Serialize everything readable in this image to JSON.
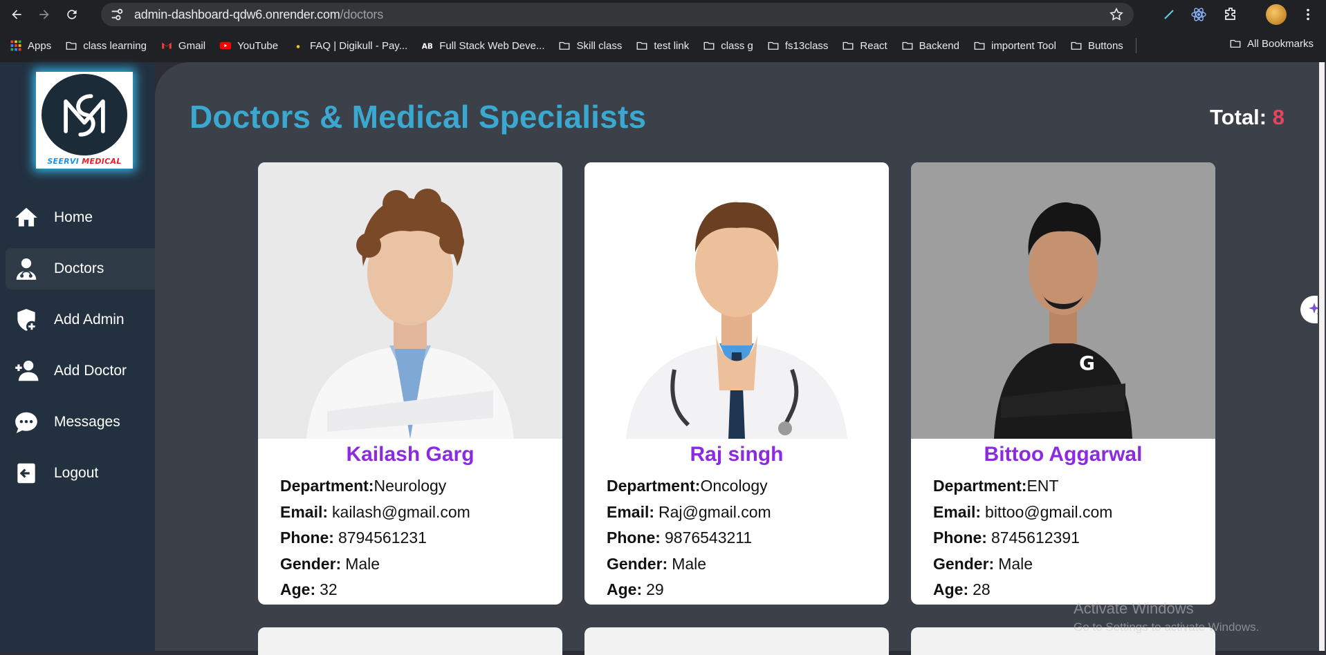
{
  "browser": {
    "url_host": "admin-dashboard-qdw6.onrender.com",
    "url_path": "/doctors",
    "bookmarks": [
      {
        "label": "Apps",
        "icon": "apps-grid-icon"
      },
      {
        "label": "class learning",
        "icon": "folder-icon"
      },
      {
        "label": "Gmail",
        "icon": "gmail-icon"
      },
      {
        "label": "YouTube",
        "icon": "youtube-icon"
      },
      {
        "label": "FAQ | Digikull - Pay...",
        "icon": "digikull-icon"
      },
      {
        "label": "Full Stack Web Deve...",
        "icon": "ab-icon"
      },
      {
        "label": "Skill class",
        "icon": "folder-icon"
      },
      {
        "label": "test link",
        "icon": "folder-icon"
      },
      {
        "label": "class g",
        "icon": "folder-icon"
      },
      {
        "label": "fs13class",
        "icon": "folder-icon"
      },
      {
        "label": "React",
        "icon": "folder-icon"
      },
      {
        "label": "Backend",
        "icon": "folder-icon"
      },
      {
        "label": "importent Tool",
        "icon": "folder-icon"
      },
      {
        "label": "Buttons",
        "icon": "folder-icon"
      }
    ],
    "all_bookmarks": "All Bookmarks"
  },
  "sidebar": {
    "logo_text_1": "SEERVI",
    "logo_text_2": "MEDICAL",
    "items": [
      {
        "label": "Home",
        "icon": "home-icon"
      },
      {
        "label": "Doctors",
        "icon": "doctor-icon",
        "active": true
      },
      {
        "label": "Add Admin",
        "icon": "shield-plus-icon"
      },
      {
        "label": "Add Doctor",
        "icon": "user-plus-icon"
      },
      {
        "label": "Messages",
        "icon": "chat-bubble-icon"
      },
      {
        "label": "Logout",
        "icon": "logout-icon"
      }
    ]
  },
  "main": {
    "title": "Doctors & Medical Specialists",
    "total_label": "Total:",
    "total_value": "8",
    "labels": {
      "department": "Department:",
      "email": "Email:",
      "phone": "Phone:",
      "gender": "Gender:",
      "age": "Age:"
    },
    "doctors": [
      {
        "name": "Kailash Garg",
        "department": "Neurology",
        "email": "kailash@gmail.com",
        "phone": "8794561231",
        "gender": "Male",
        "age": "32"
      },
      {
        "name": "Raj singh",
        "department": "Oncology",
        "email": "Raj@gmail.com",
        "phone": "9876543211",
        "gender": "Male",
        "age": "29"
      },
      {
        "name": "Bittoo Aggarwal",
        "department": "ENT",
        "email": "bittoo@gmail.com",
        "phone": "8745612391",
        "gender": "Male",
        "age": "28"
      }
    ]
  },
  "watermark": {
    "line1": "Activate Windows",
    "line2": "Go to Settings to activate Windows."
  }
}
